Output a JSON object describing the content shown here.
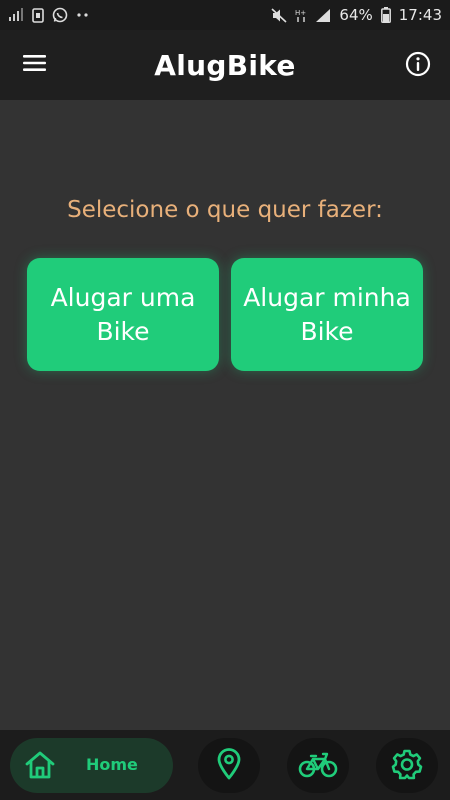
{
  "status_bar": {
    "battery": "64%",
    "time": "17:43",
    "icons_left": [
      "signal-off-icon",
      "sim-icon",
      "whatsapp-icon",
      "dots-icon"
    ],
    "icons_right": [
      "mute-icon",
      "hplus-data-icon",
      "signal-icon",
      "battery-icon"
    ]
  },
  "app_bar": {
    "title": "AlugBike",
    "icons": [
      "menu-icon",
      "info-icon"
    ]
  },
  "main": {
    "prompt": "Selecione o que quer fazer:",
    "rent_bike_label": "Alugar uma Bike",
    "rent_mine_label": "Alugar minha Bike"
  },
  "bottom_nav": {
    "home_label": "Home",
    "items": [
      "home-icon",
      "map-pin-icon",
      "bicycle-icon",
      "gear-icon"
    ]
  },
  "colors": {
    "accent": "#20cc7a",
    "prompt": "#e8b07a",
    "background": "#333333",
    "app_bar": "#1f1f1f"
  }
}
